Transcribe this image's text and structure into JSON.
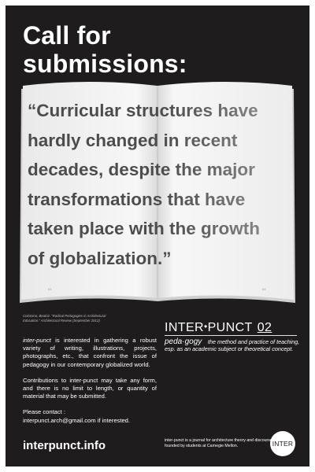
{
  "headline": "Call for\nsubmissions:",
  "quote": "“Curricular structures have\nhardly changed in recent\ndecades, despite the major\ntransformations that have\ntaken place with the growth\nof globalization.”",
  "book": {
    "page_left": "64",
    "page_right": "65"
  },
  "citation": "Colomina, Beatriz. “Radical Pedagogies in Architectural\nEducation.” Architectural Review (September 2012)",
  "brand": {
    "name_left": "INTER",
    "dot": "•",
    "name_right": "PUNCT",
    "issue": "02"
  },
  "definition": {
    "term": "peda·gogy",
    "text": "the method and practice of teaching, esp. as an academic subject or theoretical concept."
  },
  "body": {
    "p1_lead": "inter-punct",
    "p1_rest": " is interested in gathering a robust variety of writing, illustrations, projects, photographs, etc., that confront the issue of pedagogy in our contemporary globalized world.",
    "p2": "Contributions to inter-punct may take any form, and there is no limit to length, or quantity of material that may be submitted.",
    "p3_label": "Please contact :",
    "p3_email": "interpunct.arch@gmail.com if interested."
  },
  "url": "interpunct.info",
  "footer_note": "inter-punct is a journal for architecture theory and discourse founded by students at Carnegie Mellon.",
  "logo_text": "INTER",
  "colors": {
    "background": "#1e1c1c",
    "text": "#ffffff",
    "quote_text": "#4b4b4b",
    "page": "#f2f2f2"
  }
}
